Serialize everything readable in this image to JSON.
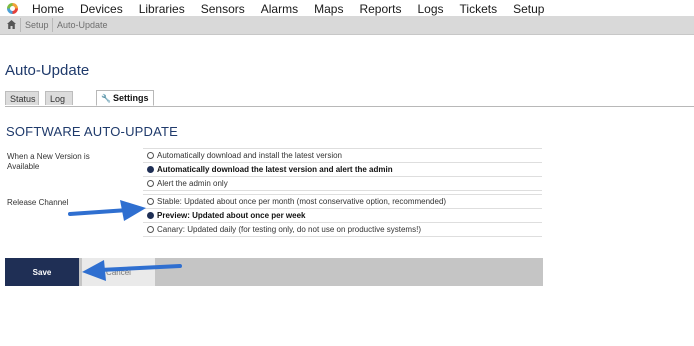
{
  "nav": {
    "items": [
      "Home",
      "Devices",
      "Libraries",
      "Sensors",
      "Alarms",
      "Maps",
      "Reports",
      "Logs",
      "Tickets",
      "Setup"
    ]
  },
  "breadcrumb": {
    "items": [
      "Setup",
      "Auto-Update"
    ]
  },
  "page": {
    "title": "Auto-Update"
  },
  "tabs": [
    {
      "label": "Status",
      "active": false
    },
    {
      "label": "Log",
      "active": false
    },
    {
      "label": "Settings",
      "active": true
    }
  ],
  "section": {
    "title": "SOFTWARE AUTO-UPDATE"
  },
  "new_version": {
    "label_line1": "When a New Version is",
    "label_line2": "Available",
    "options": [
      {
        "label": "Automatically download and install the latest version",
        "selected": false
      },
      {
        "label": "Automatically download the latest version and alert the admin",
        "selected": true
      },
      {
        "label": "Alert the admin only",
        "selected": false
      }
    ]
  },
  "release_channel": {
    "label": "Release Channel",
    "options": [
      {
        "label": "Stable: Updated about once per month (most conservative option, recommended)",
        "selected": false
      },
      {
        "label": "Preview: Updated about once per week",
        "selected": true
      },
      {
        "label": "Canary: Updated daily (for testing only, do not use on productive systems!)",
        "selected": false
      }
    ]
  },
  "buttons": {
    "save": "Save",
    "cancel": "Cancel"
  },
  "colors": {
    "accent": "#1f2f55",
    "annotation_arrow": "#2f6fd0"
  }
}
